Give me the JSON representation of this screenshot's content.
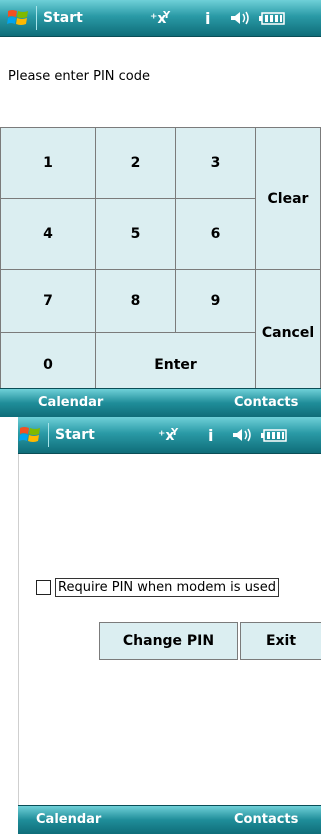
{
  "status_bar": {
    "start_label": "Start",
    "icons": [
      "windows-logo",
      "connectivity-icon",
      "info-icon",
      "volume-icon",
      "battery-icon"
    ]
  },
  "pin_entry": {
    "prompt": "Please enter PIN code",
    "keys": {
      "k1": "1",
      "k2": "2",
      "k3": "3",
      "k4": "4",
      "k5": "5",
      "k6": "6",
      "k7": "7",
      "k8": "8",
      "k9": "9",
      "k0": "0",
      "enter": "Enter",
      "clear": "Clear",
      "cancel": "Cancel"
    }
  },
  "settings": {
    "require_pin_label": "Require PIN when modem is used",
    "require_pin_checked": false,
    "change_pin_label": "Change PIN",
    "exit_label": "Exit"
  },
  "softkeys": {
    "left": "Calendar",
    "right": "Contacts"
  },
  "colors": {
    "titlebar": "#2a9aa6",
    "key_bg": "#dbeef1",
    "key_border": "#7b7b7b"
  }
}
